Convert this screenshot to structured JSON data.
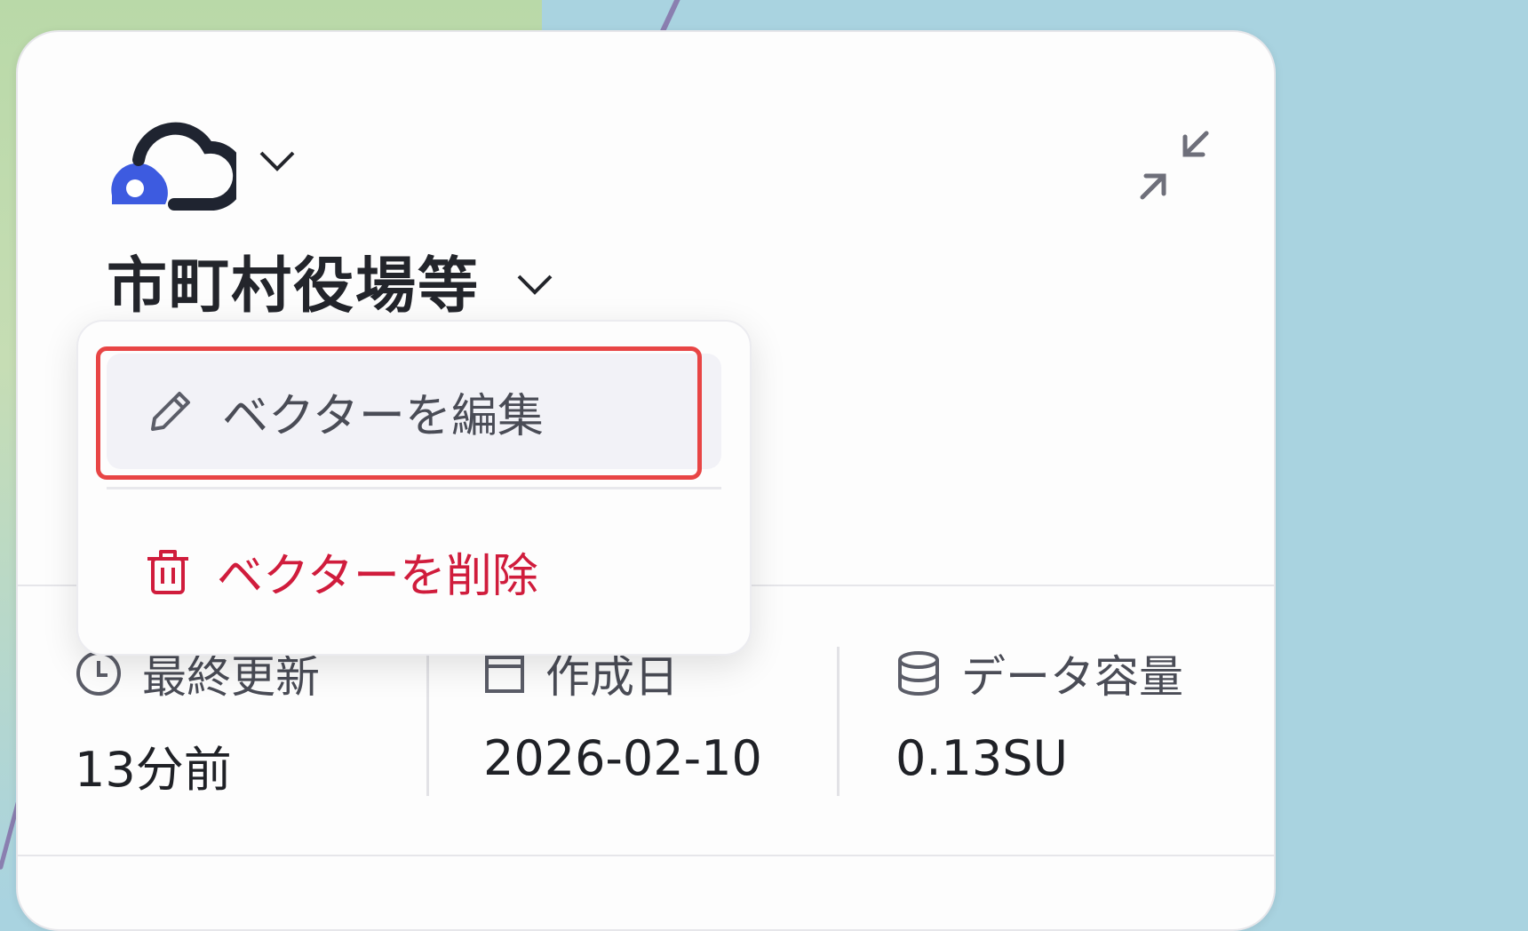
{
  "title": "市町村役場等",
  "menu": {
    "items": [
      {
        "label": "ベクターを編集",
        "icon": "pencil-icon"
      },
      {
        "label": "ベクターを削除",
        "icon": "trash-icon"
      }
    ]
  },
  "stats": [
    {
      "label": "最終更新",
      "value": "13分前",
      "icon": "clock-icon"
    },
    {
      "label": "作成日",
      "value": "2026-02-10",
      "icon": "calendar-icon"
    },
    {
      "label": "データ容量",
      "value": "0.13SU",
      "icon": "database-icon"
    }
  ],
  "colors": {
    "accent": "#3d5be0",
    "danger": "#d01c3c",
    "highlight_box": "#e84545",
    "map_water": "#a9d3e0"
  }
}
